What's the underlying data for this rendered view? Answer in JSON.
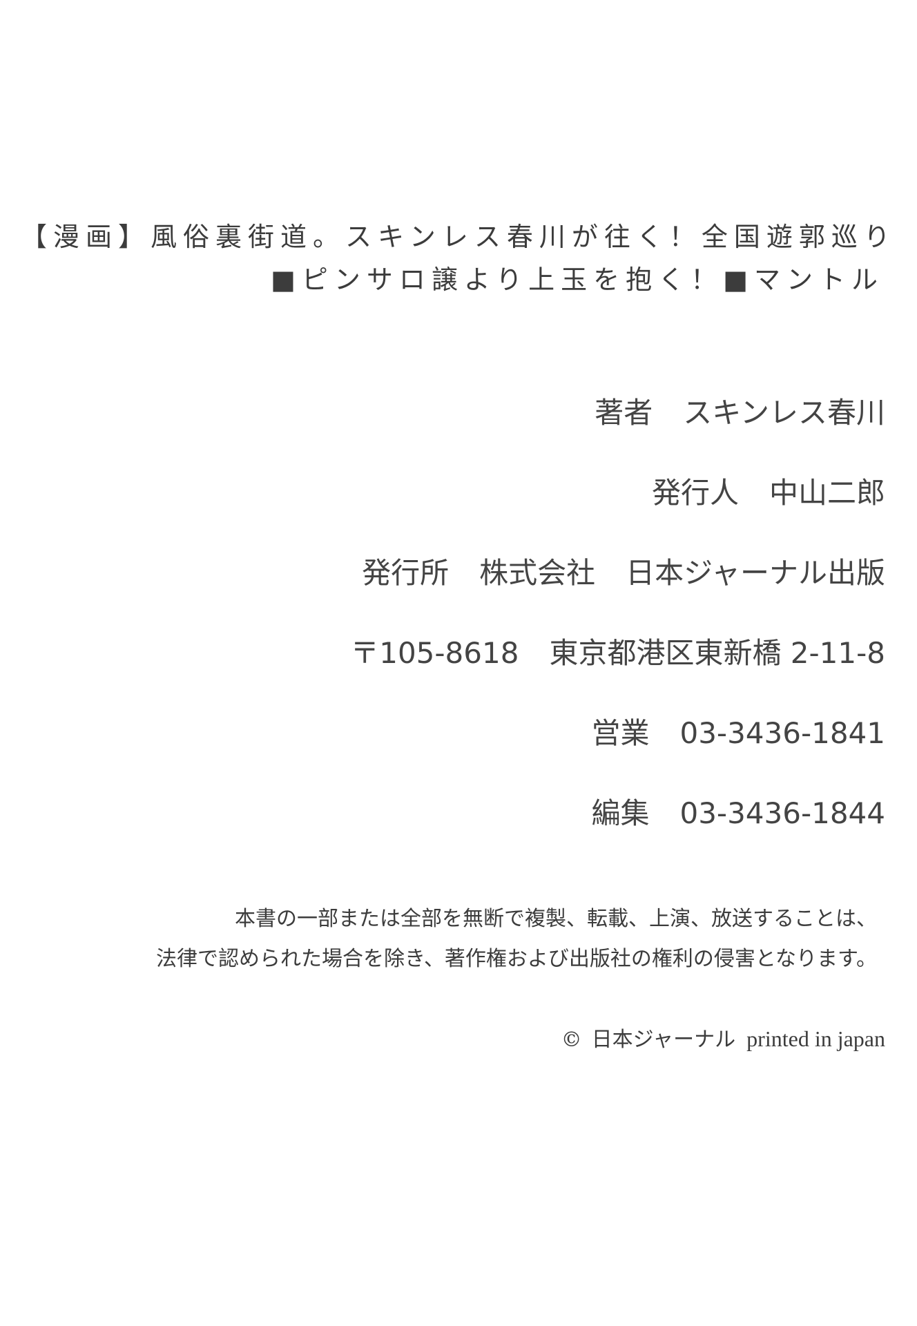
{
  "title": {
    "line1": "【漫画】風俗裏街道。スキンレス春川が往く！全国遊郭巡り",
    "line2": "■ピンサロ譲より上玉を抱く！■マントル"
  },
  "colophon": {
    "author_label": "著者",
    "author_value": "スキンレス春川",
    "publisher_person_label": "発行人",
    "publisher_person_value": "中山二郎",
    "publisher_label": "発行所",
    "publisher_company_type": "株式会社",
    "publisher_company_name": "日本ジャーナル出版",
    "postal_code": "〒105-8618",
    "address": "東京都港区東新橋 2-11-8",
    "sales_label": "営業",
    "sales_phone": "03-3436-1841",
    "editorial_label": "編集",
    "editorial_phone": "03-3436-1844"
  },
  "notice": {
    "line1": "本書の一部または全部を無断で複製、転載、上演、放送することは、",
    "line2": "法律で認められた場合を除き、著作権および出版社の権利の侵害となります。"
  },
  "copyright": {
    "symbol": "©",
    "holder": "日本ジャーナル",
    "printed": "printed in japan"
  }
}
